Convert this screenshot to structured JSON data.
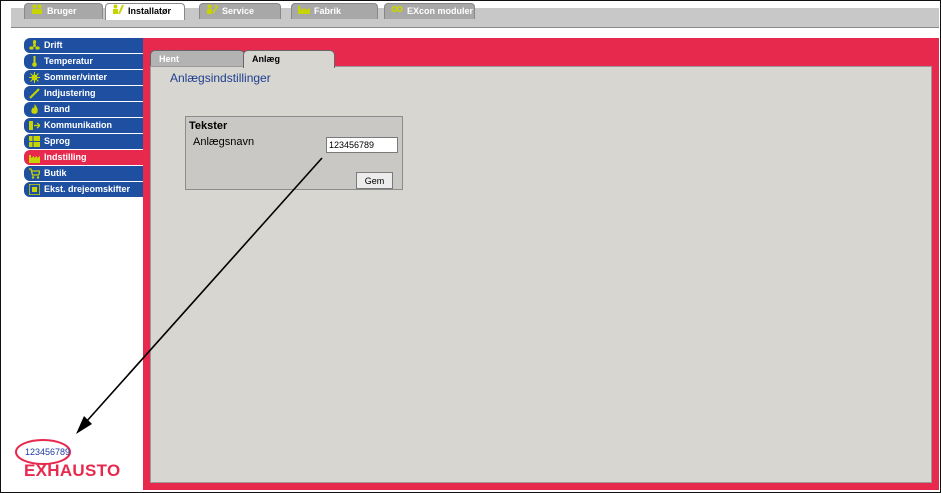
{
  "top_tabs": [
    {
      "label": "Bruger",
      "icon": "people-icon"
    },
    {
      "label": "Installatør",
      "icon": "installer-icon"
    },
    {
      "label": "Service",
      "icon": "service-icon"
    },
    {
      "label": "Fabrik",
      "icon": "factory-icon"
    },
    {
      "label": "EXcon moduler",
      "icon": "module-icon"
    }
  ],
  "nav": [
    {
      "label": "Drift",
      "icon": "fan-icon"
    },
    {
      "label": "Temperatur",
      "icon": "thermometer-icon"
    },
    {
      "label": "Sommer/vinter",
      "icon": "sun-icon"
    },
    {
      "label": "Indjustering",
      "icon": "screwdriver-icon"
    },
    {
      "label": "Brand",
      "icon": "fire-icon"
    },
    {
      "label": "Kommunikation",
      "icon": "communication-icon"
    },
    {
      "label": "Sprog",
      "icon": "language-icon"
    },
    {
      "label": "Indstilling",
      "icon": "settings-icon"
    },
    {
      "label": "Butik",
      "icon": "cart-icon"
    },
    {
      "label": "Ekst. drejeomskifter",
      "icon": "switch-icon"
    }
  ],
  "content_tabs": {
    "hent": "Hent",
    "anlaeg": "Anlæg"
  },
  "page_title": "Anlægsindstillinger",
  "group": {
    "title": "Tekster",
    "field_label": "Anlægsnavn",
    "field_value": "123456789",
    "button_label": "Gem"
  },
  "footer": {
    "system_name": "123456789",
    "logo_text": "EXHAUSTO"
  },
  "colors": {
    "accent": "#e8294e",
    "nav_blue": "#1f4fa0",
    "icon_green": "#c8d400",
    "panel": "#d7d6d1"
  }
}
